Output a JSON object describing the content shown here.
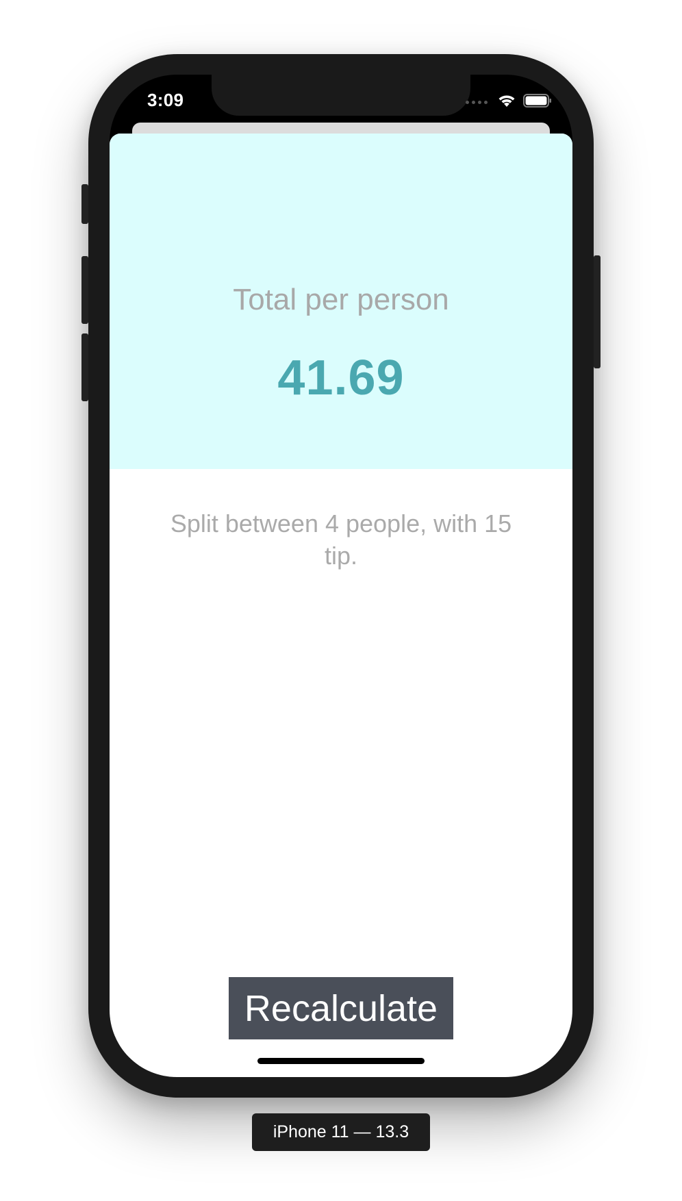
{
  "status_bar": {
    "time": "3:09",
    "icons": [
      "signal-icon",
      "wifi-icon",
      "battery-icon"
    ]
  },
  "result": {
    "total_label": "Total per person",
    "total_value": "41.69",
    "split_text": "Split between 4 people, with 15 tip."
  },
  "actions": {
    "recalculate_label": "Recalculate"
  },
  "device_label": "iPhone 11 — 13.3",
  "colors": {
    "top_panel_bg": "#dbfdfd",
    "total_value": "#4aa8b0",
    "muted_text": "#a8a8a8",
    "button_bg": "#4a4f59"
  }
}
